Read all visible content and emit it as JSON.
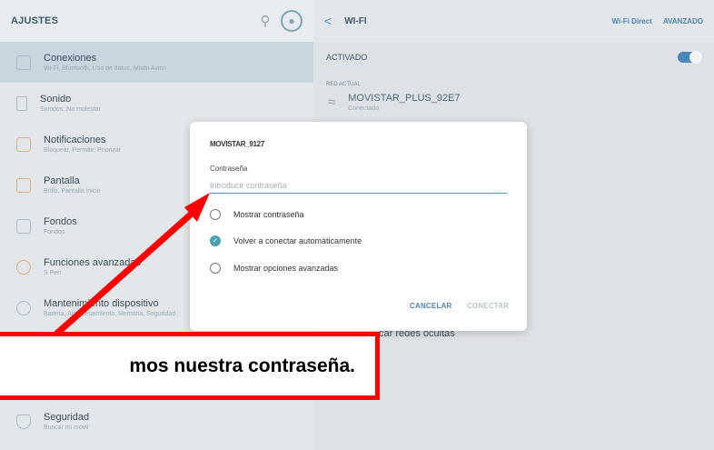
{
  "left_header": {
    "title": "AJUSTES"
  },
  "menu": [
    {
      "title": "Conexiones",
      "subtitle": "Wi-Fi, Bluetooth, Uso de datos, Modo Avión"
    },
    {
      "title": "Sonido",
      "subtitle": "Sonidos, No molestar"
    },
    {
      "title": "Notificaciones",
      "subtitle": "Bloquear, Permitir, Priorizar"
    },
    {
      "title": "Pantalla",
      "subtitle": "Brillo, Pantalla inicio"
    },
    {
      "title": "Fondos",
      "subtitle": "Fondos"
    },
    {
      "title": "Funciones avanzadas",
      "subtitle": "S Pen"
    },
    {
      "title": "Mantenimiento dispositivo",
      "subtitle": "Batería, Almacenamiento, Memoria, Seguridad"
    },
    {
      "title": "Seguridad",
      "subtitle": "Buscar mi móvil"
    }
  ],
  "right_header": {
    "back": "<",
    "title": "WI-FI",
    "wifi_direct": "Wi-Fi Direct",
    "advanced": "AVANZADO"
  },
  "activado": {
    "label": "ACTIVADO",
    "on": true
  },
  "current_network": {
    "section": "RED ACTUAL",
    "name": "MOVISTAR_PLUS_92E7",
    "status": "Conectado"
  },
  "hidden_networks": "car redes ocultas",
  "dialog": {
    "ssid": "MOVISTAR_9127",
    "password_label": "Contraseña",
    "password_placeholder": "Introducir contraseña",
    "password_value": "",
    "options": [
      {
        "label": "Mostrar contraseña",
        "checked": false
      },
      {
        "label": "Volver a conectar automáticamente",
        "checked": true
      },
      {
        "label": "Mostrar opciones avanzadas",
        "checked": false
      }
    ],
    "cancel": "CANCELAR",
    "connect": "CONECTAR"
  },
  "annotation": {
    "text": "mos nuestra contraseña.",
    "color": "#ff0000"
  },
  "colors": {
    "accent": "#4b9fb2",
    "link": "#4b86b8"
  }
}
